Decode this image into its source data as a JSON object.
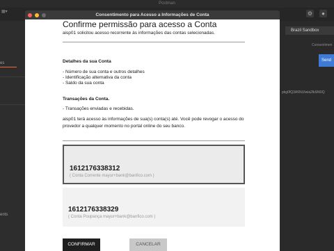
{
  "app": {
    "title": "Postman"
  },
  "postman_bg": {
    "sidebar_tab": "es",
    "sidebar_bottom": "ents",
    "environment": "Brazil Sandbox",
    "consent_tab": "Consentimen",
    "send_label": "Send",
    "url_fragment": "pkg0fQ3A5NUIwia2lkIIA6IQ"
  },
  "dialog": {
    "window_title": "Consentimento para Acesso a Informações de Conta",
    "heading": "Confirme permissão para acesso a Conta",
    "intro": "aisp01 solicitou acesso recorrente às informações das contas selecionadas.",
    "details_heading": "Detalhes da sua Conta",
    "details_items": [
      "- Número de sua conta e outros detalhes",
      "- Identificação alternativa da conta",
      "- Saldo da sua conta"
    ],
    "transactions_heading": "Transações da Conta.",
    "transactions_items": [
      "- Transações enviadas e recebidas."
    ],
    "notice": "aisp01 terá acesso às informações de sua(s) conta(s) até. Você pode revogar o acesso do provedor a qualquer momento no portal online do seu banco.",
    "accounts": [
      {
        "number": "1612176338312",
        "description": "( Conta Corrente mayur+bank@banfico.com )",
        "selected": true
      },
      {
        "number": "1612176338329",
        "description": "( Conta Poupança mayur+bank@banfico.com )",
        "selected": false
      }
    ],
    "confirm_label": "CONFIRMAR",
    "cancel_label": "CANCELAR"
  },
  "colors": {
    "accent_dark": "#1f1f1f",
    "postman_orange": "#f26b3a",
    "send_blue": "#3e7bd6"
  }
}
